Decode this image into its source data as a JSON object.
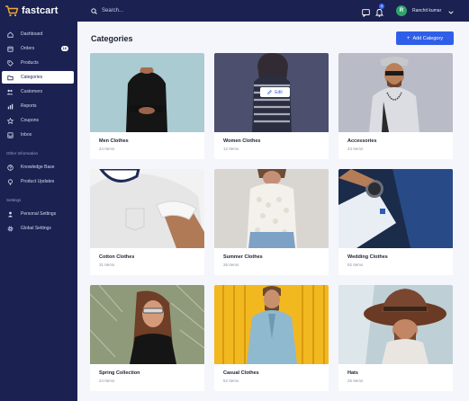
{
  "app": {
    "name": "fastcart"
  },
  "search": {
    "placeholder": "Search..."
  },
  "notifications": {
    "count": "3"
  },
  "user": {
    "initial": "R",
    "name": "Ranchit kumar"
  },
  "sidebar": {
    "main_items": [
      {
        "label": "Dashboard",
        "icon": "home-icon"
      },
      {
        "label": "Orders",
        "icon": "orders-icon",
        "badge": "16"
      },
      {
        "label": "Products",
        "icon": "tag-icon"
      },
      {
        "label": "Categories",
        "icon": "folder-icon",
        "active": true
      },
      {
        "label": "Customers",
        "icon": "users-icon"
      },
      {
        "label": "Reports",
        "icon": "chart-icon"
      },
      {
        "label": "Coupons",
        "icon": "star-icon"
      },
      {
        "label": "Inbox",
        "icon": "inbox-icon"
      }
    ],
    "other_title": "Other Information",
    "other_items": [
      {
        "label": "Knowledge Base",
        "icon": "help-icon"
      },
      {
        "label": "Product Updates",
        "icon": "bulb-icon"
      }
    ],
    "settings_title": "Settings",
    "settings_items": [
      {
        "label": "Personal Settings",
        "icon": "person-icon"
      },
      {
        "label": "Global Settings",
        "icon": "gear-icon"
      }
    ]
  },
  "page": {
    "title": "Categories",
    "add_button": "Add Category",
    "edit_label": "Edit"
  },
  "categories": [
    {
      "name": "Men Clothes",
      "count": "24 Items"
    },
    {
      "name": "Women Clothes",
      "count": "12 Items"
    },
    {
      "name": "Accessories",
      "count": "43 Items"
    },
    {
      "name": "Cotton Clothes",
      "count": "31 Items"
    },
    {
      "name": "Summer Clothes",
      "count": "26 Items"
    },
    {
      "name": "Wedding Clothes",
      "count": "52 Items"
    },
    {
      "name": "Spring Collection",
      "count": "24 Items"
    },
    {
      "name": "Casual Clothes",
      "count": "52 Items"
    },
    {
      "name": "Hats",
      "count": "26 Items"
    }
  ],
  "colors": {
    "sidebar_bg": "#1b2150",
    "accent": "#2f5fe8",
    "page_bg": "#f4f6fb"
  }
}
